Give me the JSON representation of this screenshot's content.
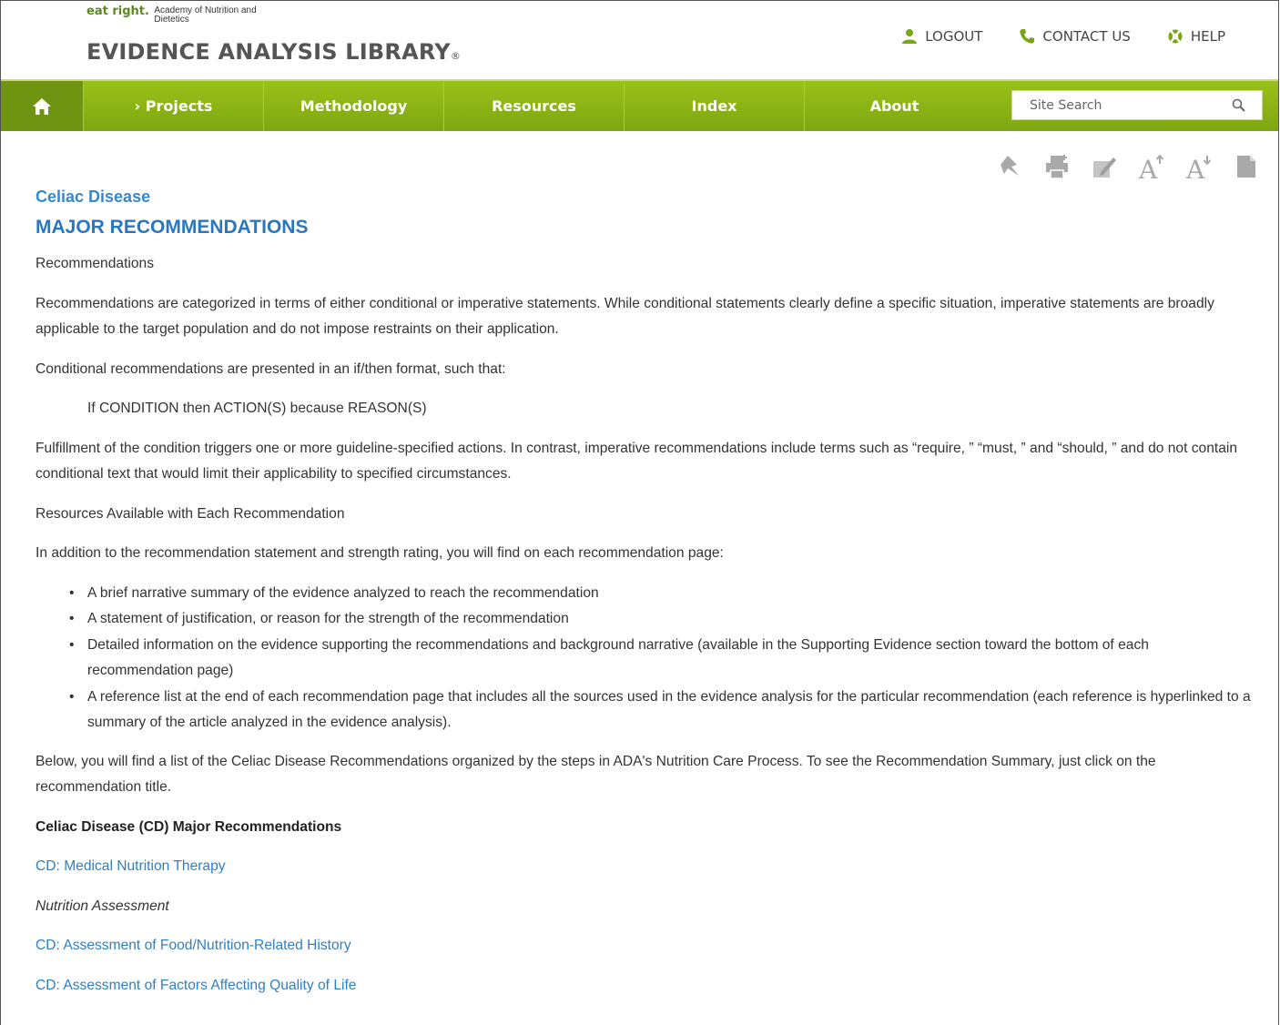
{
  "header": {
    "logo_mark": "eat right.",
    "logo_org": "Academy of Nutrition and Dietetics",
    "site_title": "EVIDENCE ANALYSIS LIBRARY",
    "site_title_mark": "®"
  },
  "utility_nav": [
    {
      "label": "LOGOUT",
      "icon": "user-icon"
    },
    {
      "label": "CONTACT US",
      "icon": "phone-icon"
    },
    {
      "label": "HELP",
      "icon": "lifebuoy-icon"
    }
  ],
  "nav": {
    "home_icon": "home-icon",
    "items": [
      "› Projects",
      "Methodology",
      "Resources",
      "Index",
      "About"
    ],
    "search_placeholder": "Site Search"
  },
  "tools": [
    "bookmark-icon",
    "print-icon",
    "edit-icon",
    "font-larger-icon",
    "font-smaller-icon",
    "document-icon"
  ],
  "content": {
    "section_label": "Celiac Disease",
    "title": "MAJOR RECOMMENDATIONS",
    "p1": "Recommendations",
    "p2": "Recommendations are categorized in terms of either conditional or imperative statements. While conditional statements clearly define a specific situation, imperative statements are broadly applicable to the target population and do not impose restraints on their application.",
    "p3": "Conditional recommendations are presented in an if/then format, such that:",
    "p4": "If CONDITION then ACTION(S) because REASON(S)",
    "p5": "Fulfillment of the condition triggers one or more guideline-specified actions. In contrast, imperative recommendations include terms such as “require, ” “must, ” and “should, ” and do not contain conditional text that would limit their applicability to specified circumstances.",
    "p6": "Resources Available with Each Recommendation",
    "p7": "In addition to the recommendation statement and strength rating, you will find on each recommendation page:",
    "bullets": [
      "A brief narrative summary of the evidence analyzed to reach the recommendation",
      "A statement of justification, or reason for the strength of the recommendation",
      "Detailed information on the evidence supporting the recommendations and background narrative (available in the Supporting Evidence section toward the bottom of each recommendation page)",
      "A reference list at the end of each recommendation page that includes all the sources used in the evidence analysis for the particular recommendation (each reference is hyperlinked to a summary of the article analyzed in the evidence analysis)."
    ],
    "p8": "Below, you will find a list of the Celiac Disease Recommendations organized by the steps in ADA's Nutrition Care Process. To see the Recommendation Summary, just click on the recommendation title.",
    "list_heading": "Celiac Disease (CD) Major Recommendations",
    "link1": "CD: Medical Nutrition Therapy",
    "subhead1": "Nutrition Assessment",
    "link2": "CD: Assessment of Food/Nutrition-Related History",
    "link3": "CD: Assessment of Factors Affecting Quality of Life"
  }
}
